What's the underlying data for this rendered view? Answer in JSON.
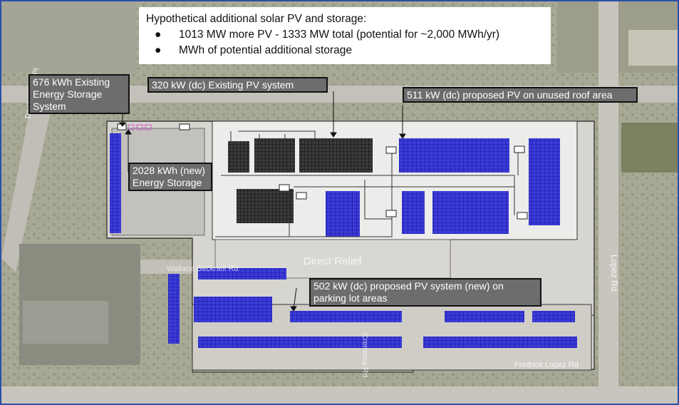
{
  "legend": {
    "title": "Hypothetical additional solar PV and storage:",
    "bullets": [
      "1013 MW more PV - 1333 MW total (potential for ~2,000 MWh/yr)",
      "MWh of potential additional storage"
    ]
  },
  "callouts": {
    "existing_storage": "676 kWh Existing Energy Storage System",
    "existing_pv": "320 kW (dc) Existing PV system",
    "proposed_roof_pv": "511 kW (dc) proposed PV on unused roof area",
    "new_storage": "2028 kWh (new) Energy Storage",
    "proposed_parking_pv": "502 kW (dc) proposed PV system (new) on parking lot areas"
  },
  "map_labels": {
    "building_name": "Direct Relief",
    "street_west": "Danbo Love Pl",
    "street_east": "Lopez Rd",
    "street_mid": "Wallace Becknell Rd",
    "street_center": "Cremona Rd",
    "street_south": "Fredrick Lopez Rd"
  },
  "colors": {
    "existing_pv": "#1a1a1a",
    "proposed_pv": "#2a2adb",
    "storage_marker": "#cc66cc",
    "callout_bg": "#6d6d6d"
  }
}
